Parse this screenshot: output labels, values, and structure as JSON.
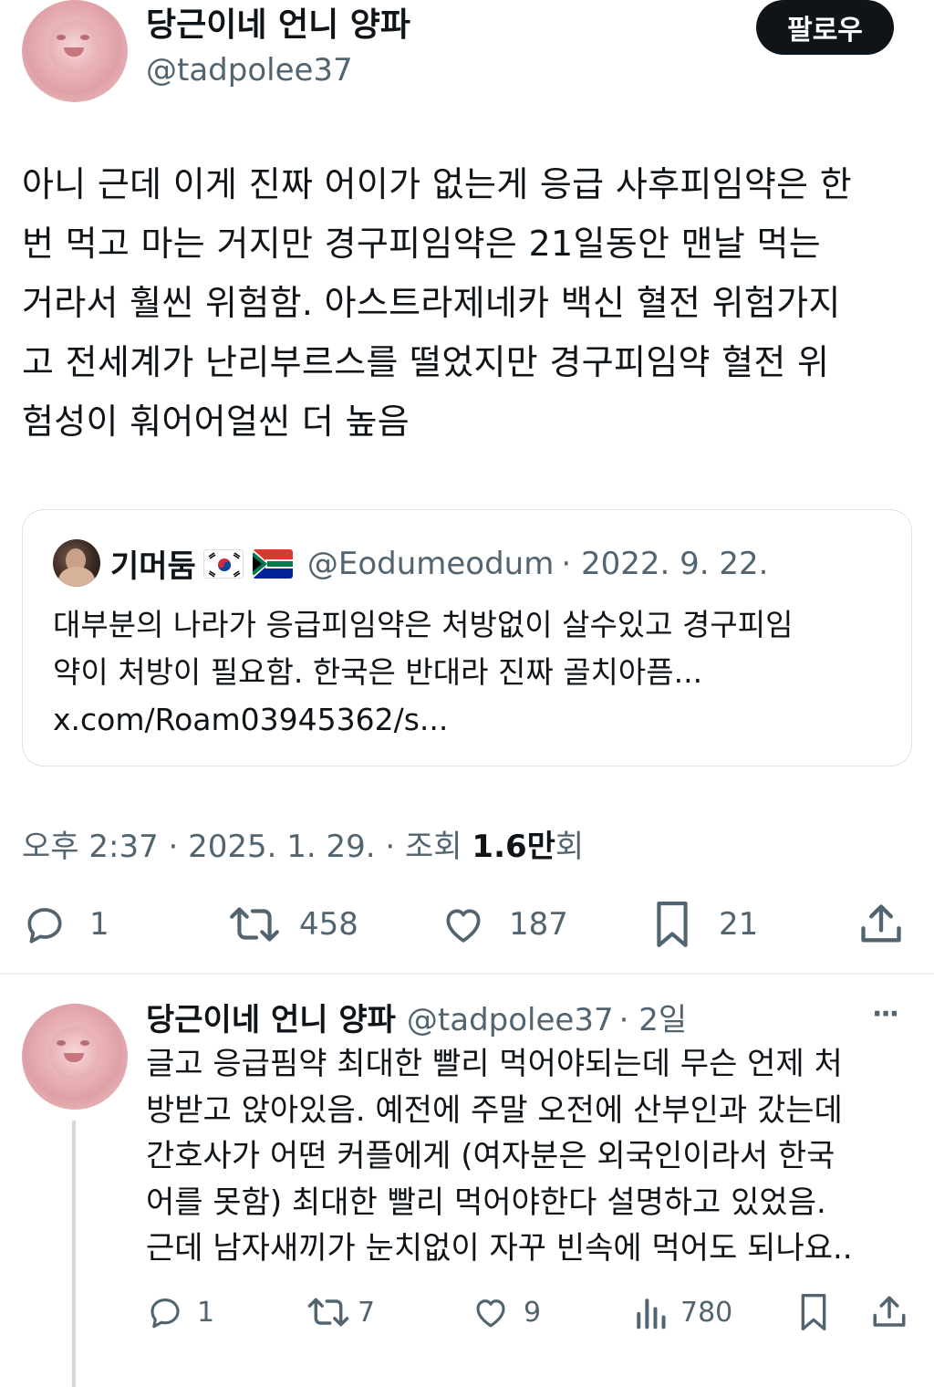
{
  "main_tweet": {
    "author_name": "당근이네 언니 양파",
    "author_handle": "@tadpolee37",
    "follow_label": "팔로우",
    "text_lines": [
      "아니 근데 이게 진짜 어이가 없는게 응급 사후피임약은 한",
      "번 먹고 마는 거지만 경구피임약은 21일동안 맨날 먹는",
      "거라서 훨씬 위험함. 아스트라제네카 백신 혈전 위험가지",
      "고 전세계가 난리부르스를 떨었지만 경구피임약 혈전 위",
      "험성이 훠어어얼씬 더 높음"
    ],
    "quote": {
      "author_name": "기머둠",
      "flags": [
        "south-korea-flag",
        "south-africa-flag"
      ],
      "author_handle": "@Eodumeodum",
      "date": "· 2022. 9. 22.",
      "text_lines": [
        "대부분의 나라가 응급피임약은 처방없이 살수있고 경구피임",
        "약이 처방이 필요함. 한국은 반대라 진짜 골치아픔...",
        "x.com/Roam03945362/s..."
      ]
    },
    "meta": {
      "time_date": "오후 2:37 · 2025. 1. 29. · 조회 ",
      "views": "1.6만",
      "views_suffix": "회"
    },
    "actions": {
      "replies": "1",
      "retweets": "458",
      "likes": "187",
      "bookmarks": "21"
    }
  },
  "reply_tweet": {
    "author_name": "당근이네 언니 양파",
    "author_handle": "@tadpolee37",
    "time": "· 2일",
    "more": "···",
    "text_lines": [
      "글고 응급핌약 최대한 빨리 먹어야되는데 무슨 언제 처",
      "방받고 앉아있음. 예전에 주말 오전에 산부인과 갔는데",
      "간호사가 어떤 커플에게 (여자분은 외국인이라서 한국",
      "어를 못함) 최대한 빨리 먹어야한다 설명하고 있었음.",
      "근데 남자새끼가 눈치없이 자꾸 빈속에 먹어도 되나요.."
    ],
    "actions": {
      "replies": "1",
      "retweets": "7",
      "likes": "9",
      "views": "780"
    }
  },
  "colors": {
    "text": "#0f1419",
    "secondary": "#536471",
    "border": "#dde3e8",
    "button": "#0f1419"
  }
}
